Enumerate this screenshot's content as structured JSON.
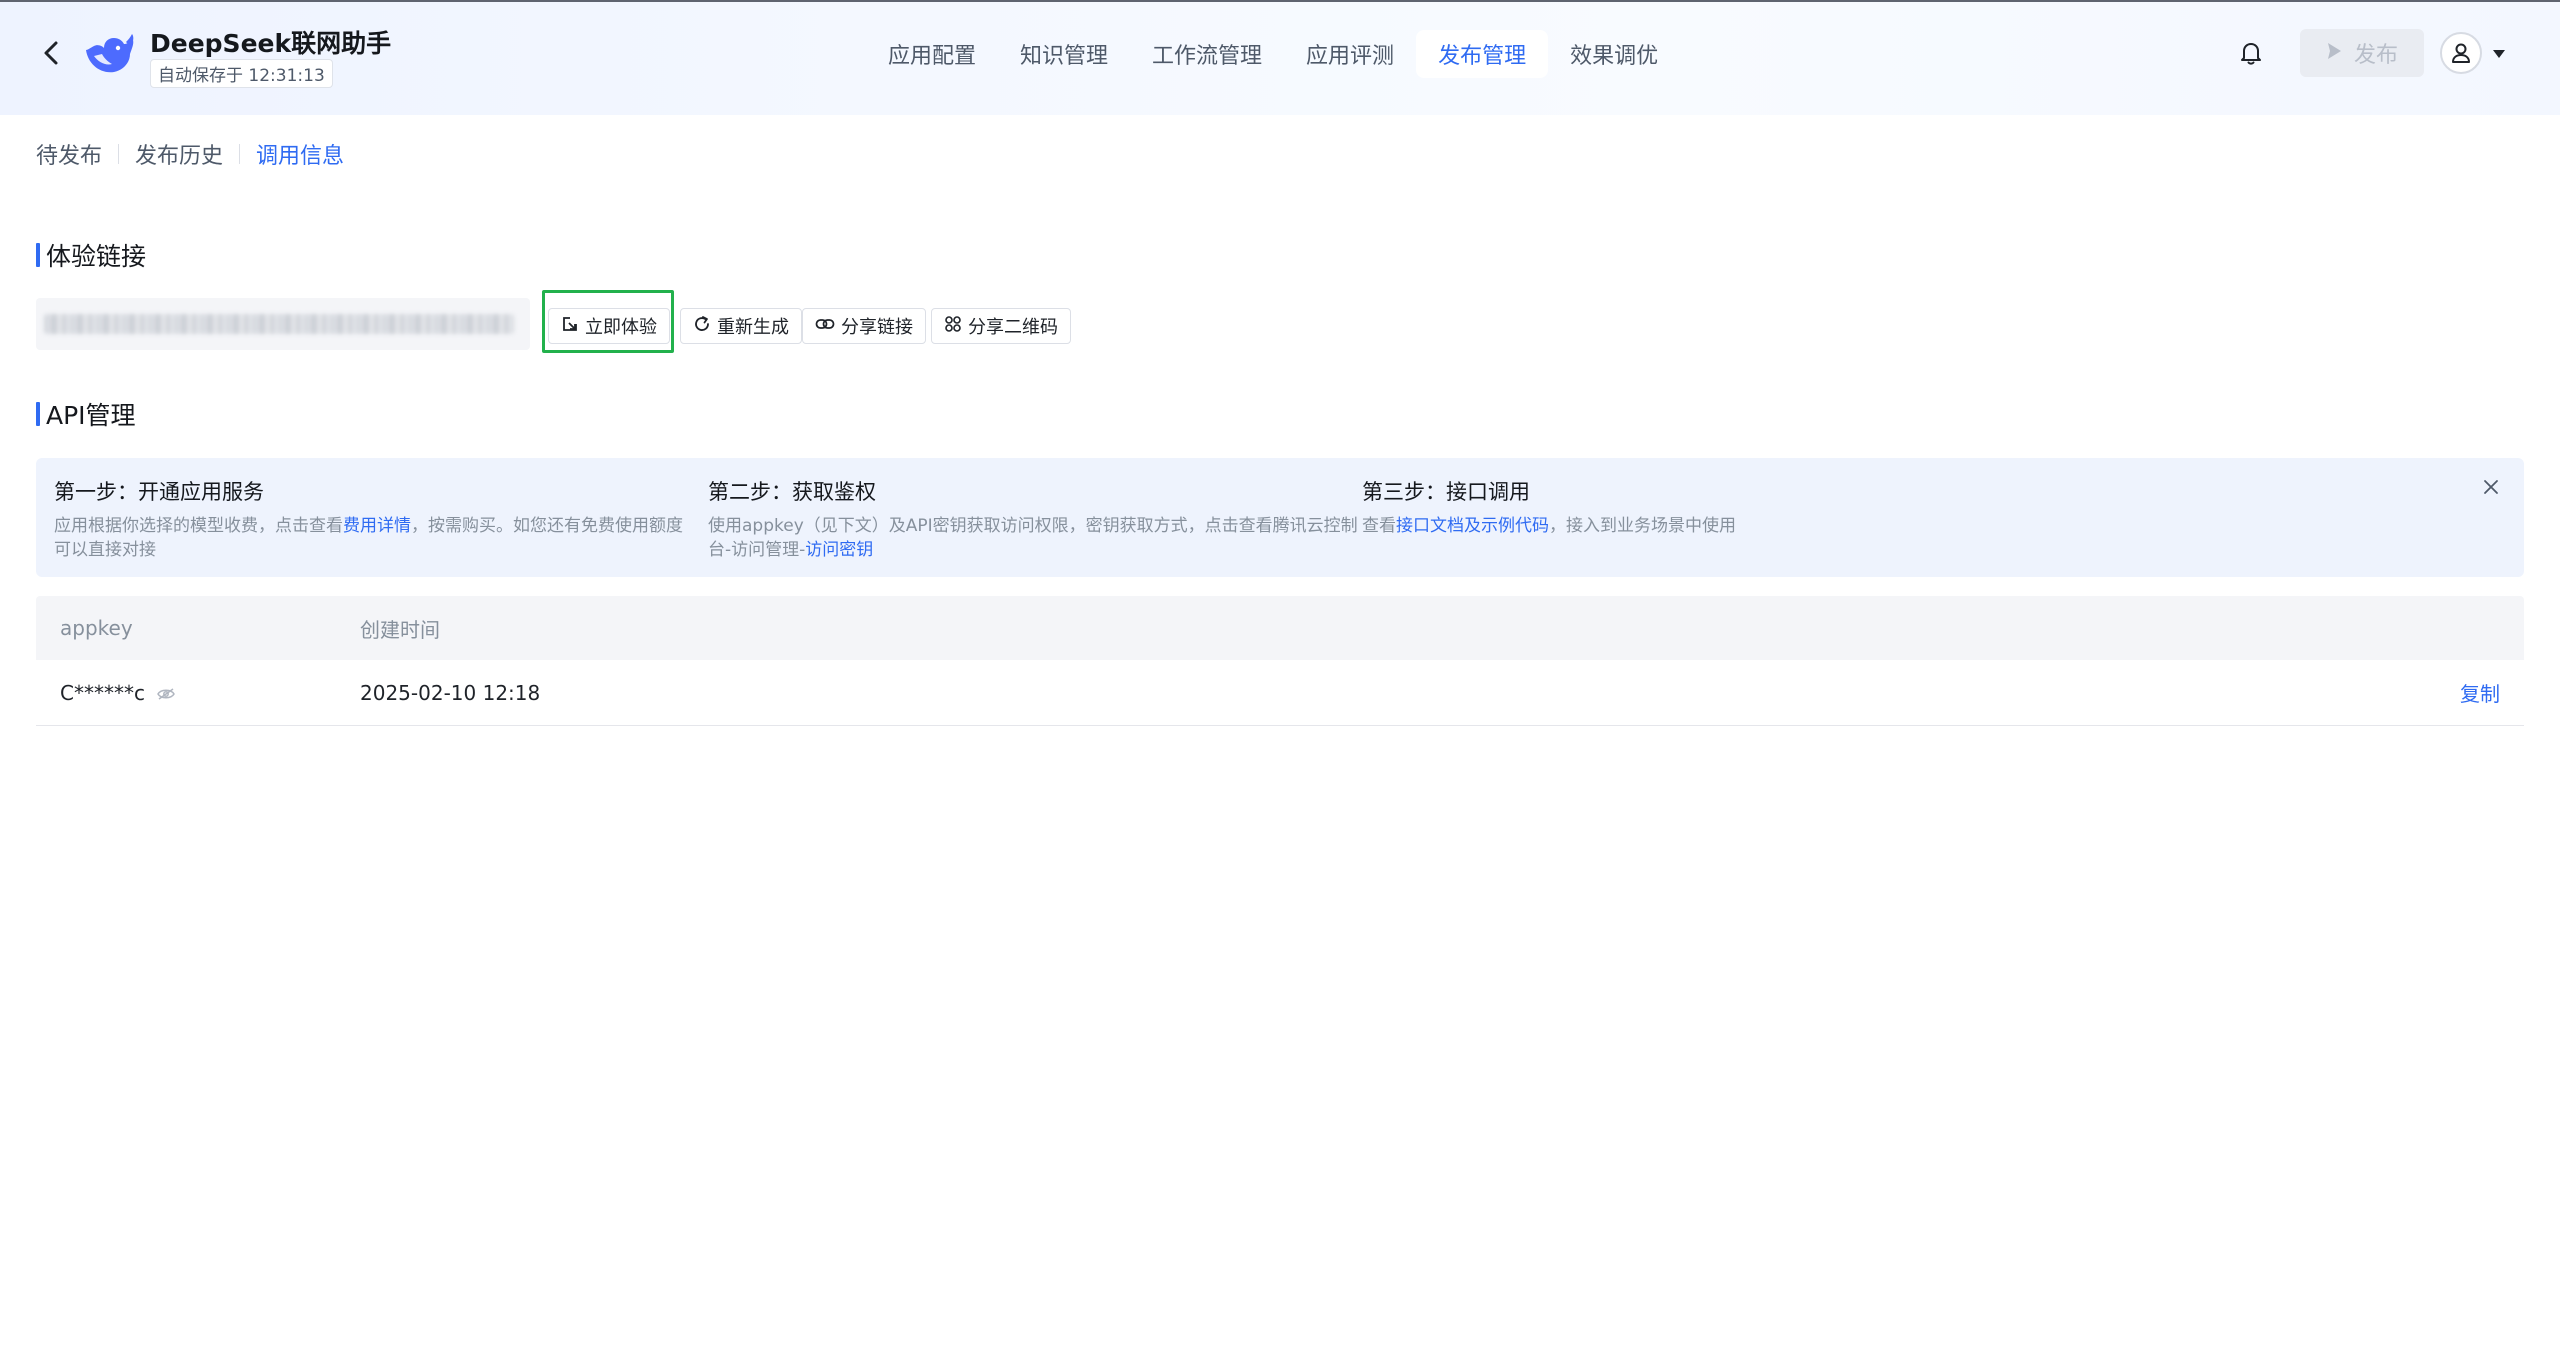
{
  "header": {
    "app_title": "DeepSeek联网助手",
    "autosave": "自动保存于 12:31:13",
    "tabs": [
      {
        "label": "应用配置"
      },
      {
        "label": "知识管理"
      },
      {
        "label": "工作流管理"
      },
      {
        "label": "应用评测"
      },
      {
        "label": "发布管理",
        "active": true
      },
      {
        "label": "效果调优"
      }
    ],
    "publish_label": "发布",
    "icons": [
      "back-arrow-icon",
      "deepseek-whale-logo",
      "bell-icon",
      "play-icon",
      "user-icon",
      "caret-down-icon"
    ]
  },
  "sub_tabs": [
    {
      "label": "待发布"
    },
    {
      "label": "发布历史"
    },
    {
      "label": "调用信息",
      "active": true
    }
  ],
  "experience": {
    "title": "体验链接",
    "link_value": "",
    "buttons": {
      "try_now": "立即体验",
      "regenerate": "重新生成",
      "share_link": "分享链接",
      "share_qr": "分享二维码"
    }
  },
  "api": {
    "title": "API管理",
    "steps": [
      {
        "title": "第一步：开通应用服务",
        "desc_before": "应用根据你选择的模型收费，点击查看",
        "link": "费用详情",
        "desc_after": "，按需购买。如您还有免费使用额度可以直接对接"
      },
      {
        "title": "第二步：获取鉴权",
        "desc_before": "使用appkey（见下文）及API密钥获取访问权限，密钥获取方式，点击查看腾讯云控制台-访问管理-",
        "link": "访问密钥",
        "desc_after": ""
      },
      {
        "title": "第三步：接口调用",
        "desc_before": "查看",
        "link": "接口文档及示例代码",
        "desc_after": "，接入到业务场景中使用"
      }
    ],
    "table": {
      "headers": [
        "appkey",
        "创建时间"
      ],
      "rows": [
        {
          "appkey": "C******c",
          "created": "2025-02-10 12:18",
          "action": "复制"
        }
      ]
    }
  },
  "colors": {
    "accent": "#2f6bf2",
    "highlight_border": "#22b14c",
    "banner_bg": "#eef3fd"
  }
}
